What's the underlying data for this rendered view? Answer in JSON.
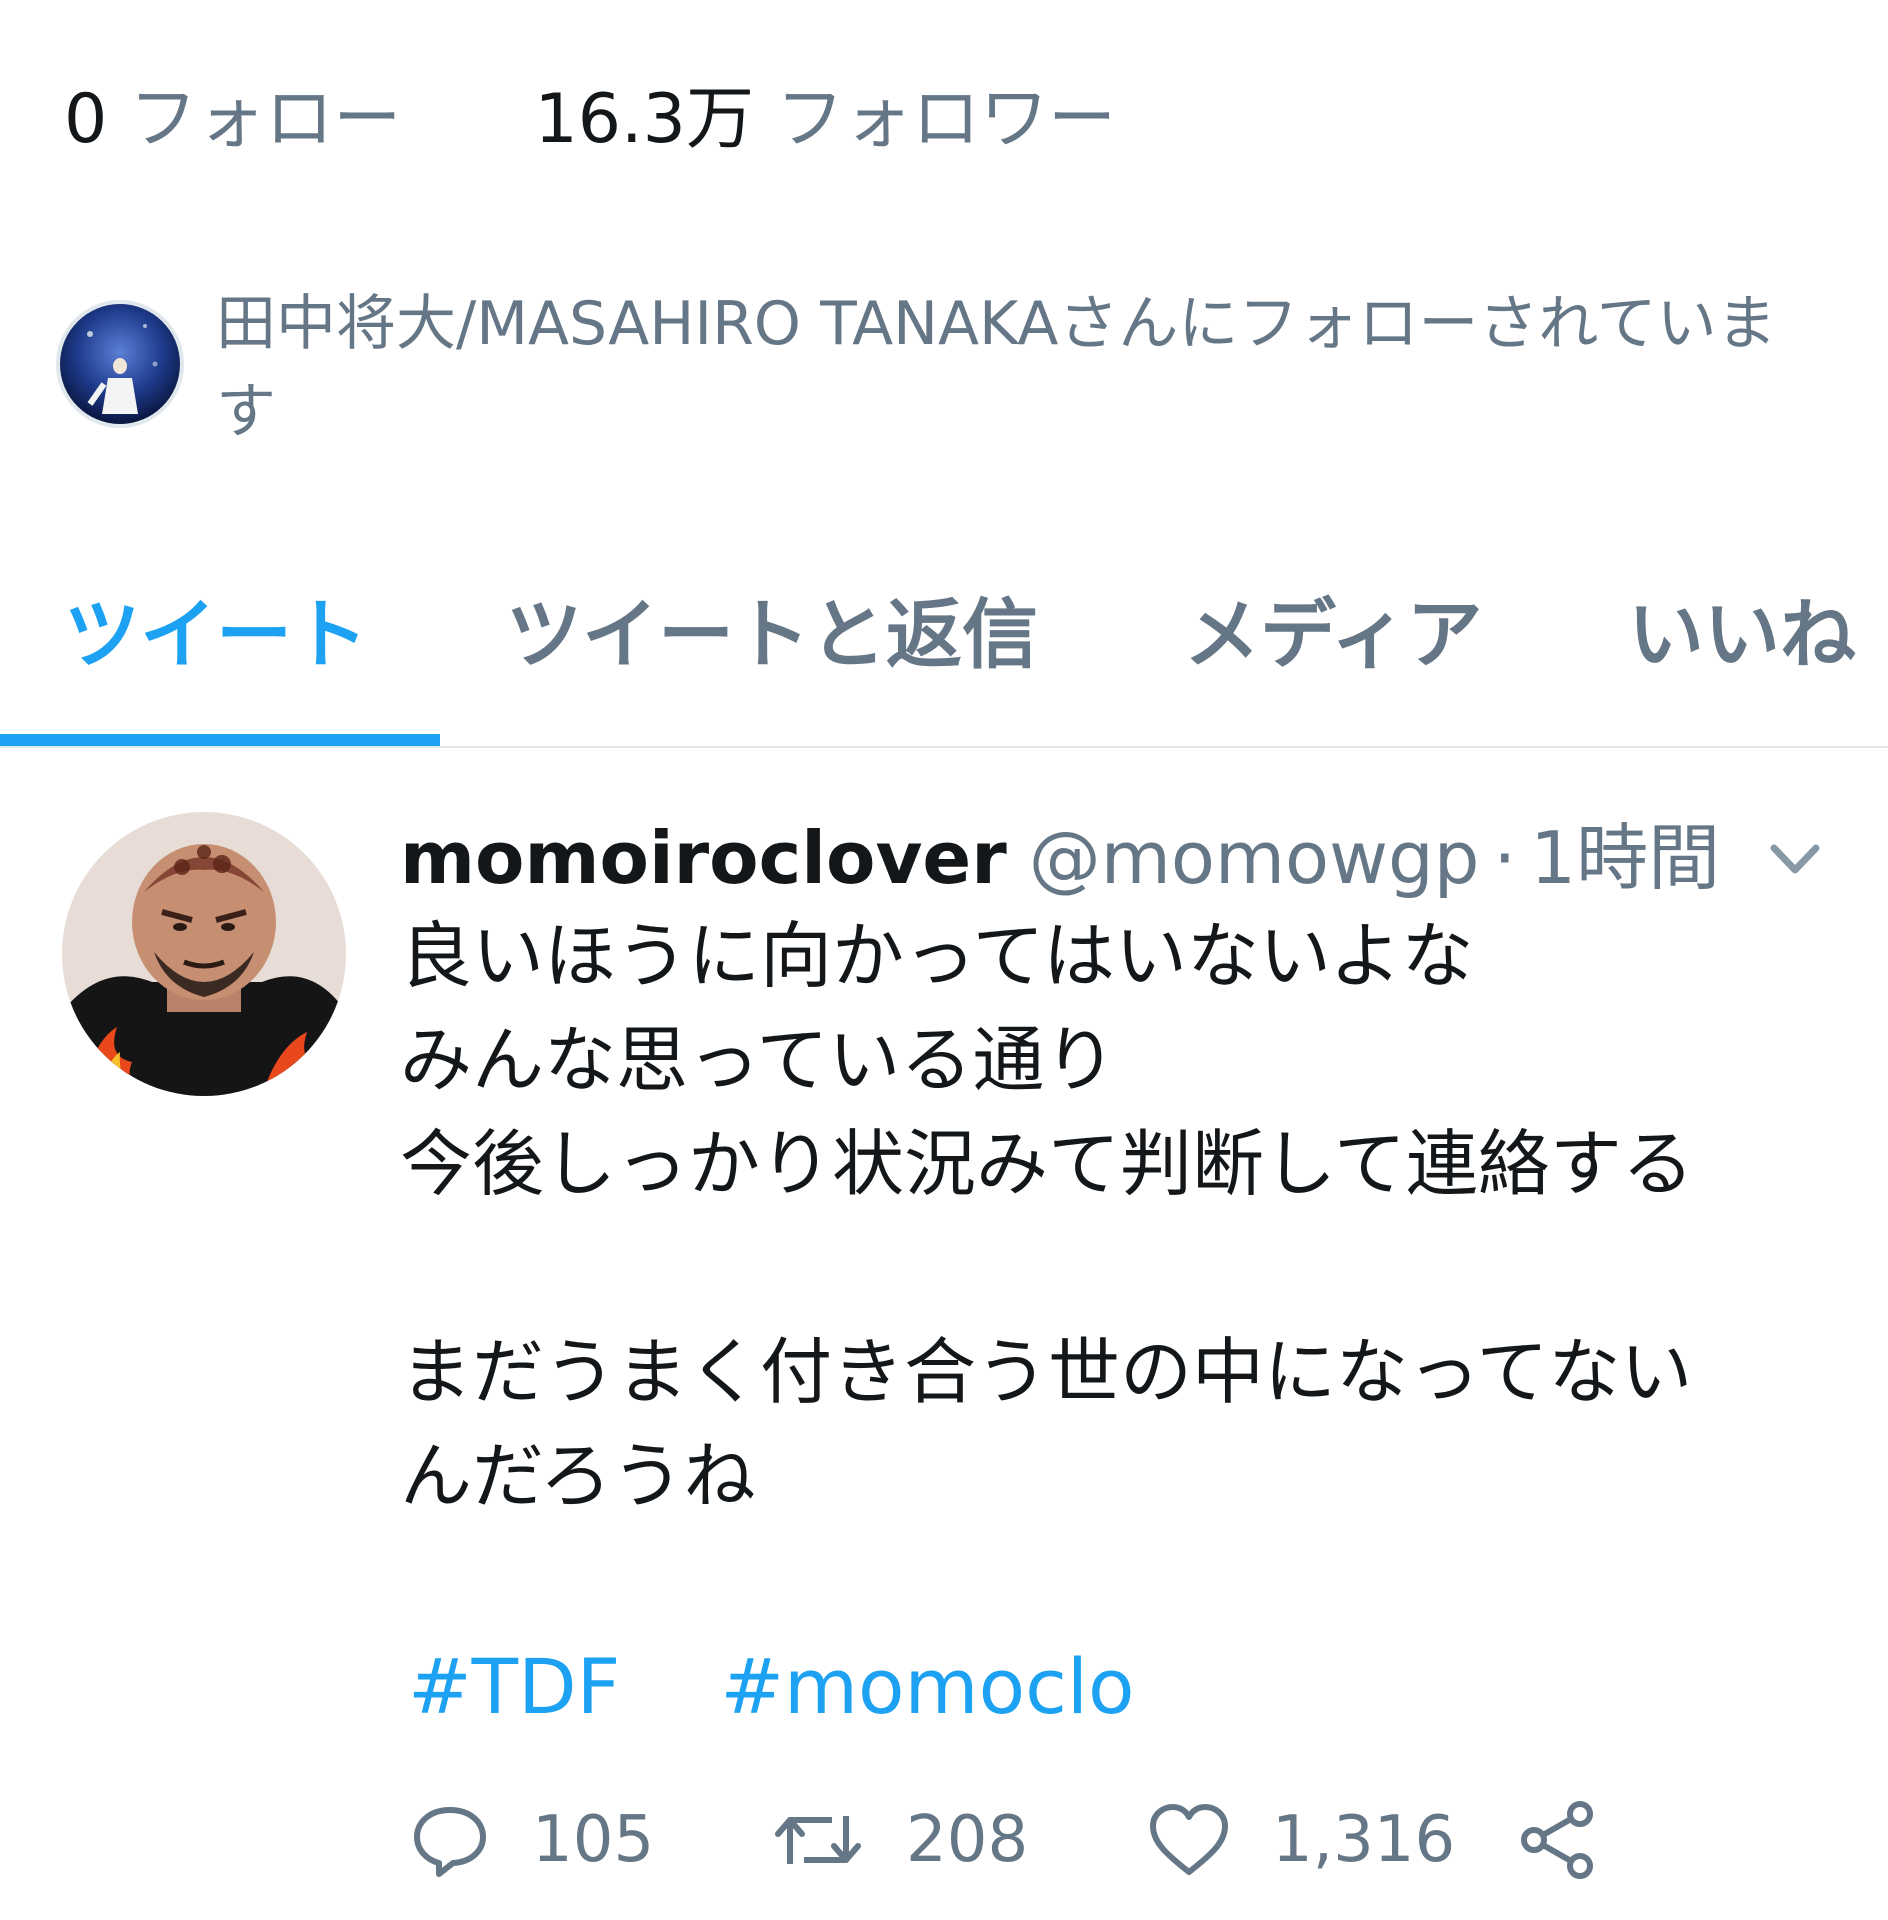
{
  "stats": {
    "following_count": "0",
    "following_label": "フォロー",
    "followers_count": "16.3万",
    "followers_label": "フォロワー"
  },
  "followed_by": {
    "text": "田中将大/MASAHIRO TANAKAさんにフォローされています"
  },
  "tabs": [
    {
      "label": "ツイート",
      "active": true
    },
    {
      "label": "ツイートと返信",
      "active": false
    },
    {
      "label": "メディア",
      "active": false
    },
    {
      "label": "いいね",
      "active": false
    }
  ],
  "tweet": {
    "display_name": "momoiroclover",
    "handle": "@momowgp",
    "separator": "·",
    "time": "1時間",
    "lines": [
      "良いほうに向かってはいないよな",
      "みんな思っている通り",
      "今後しっかり状況みて判断して連絡する",
      "",
      "まだうまく付き合う世の中になってない",
      "んだろうね"
    ],
    "hashtags": [
      "#TDF",
      "#momoclo"
    ],
    "reply_count": "105",
    "retweet_count": "208",
    "like_count": "1,316",
    "icons": {
      "reply": "reply-icon",
      "retweet": "retweet-icon",
      "like": "heart-icon",
      "share": "share-icon",
      "menu": "chevron-down-icon"
    }
  },
  "colors": {
    "accent": "#1da1f2",
    "text": "#14171a",
    "secondary": "#657786",
    "divider": "#e1e8ed"
  }
}
